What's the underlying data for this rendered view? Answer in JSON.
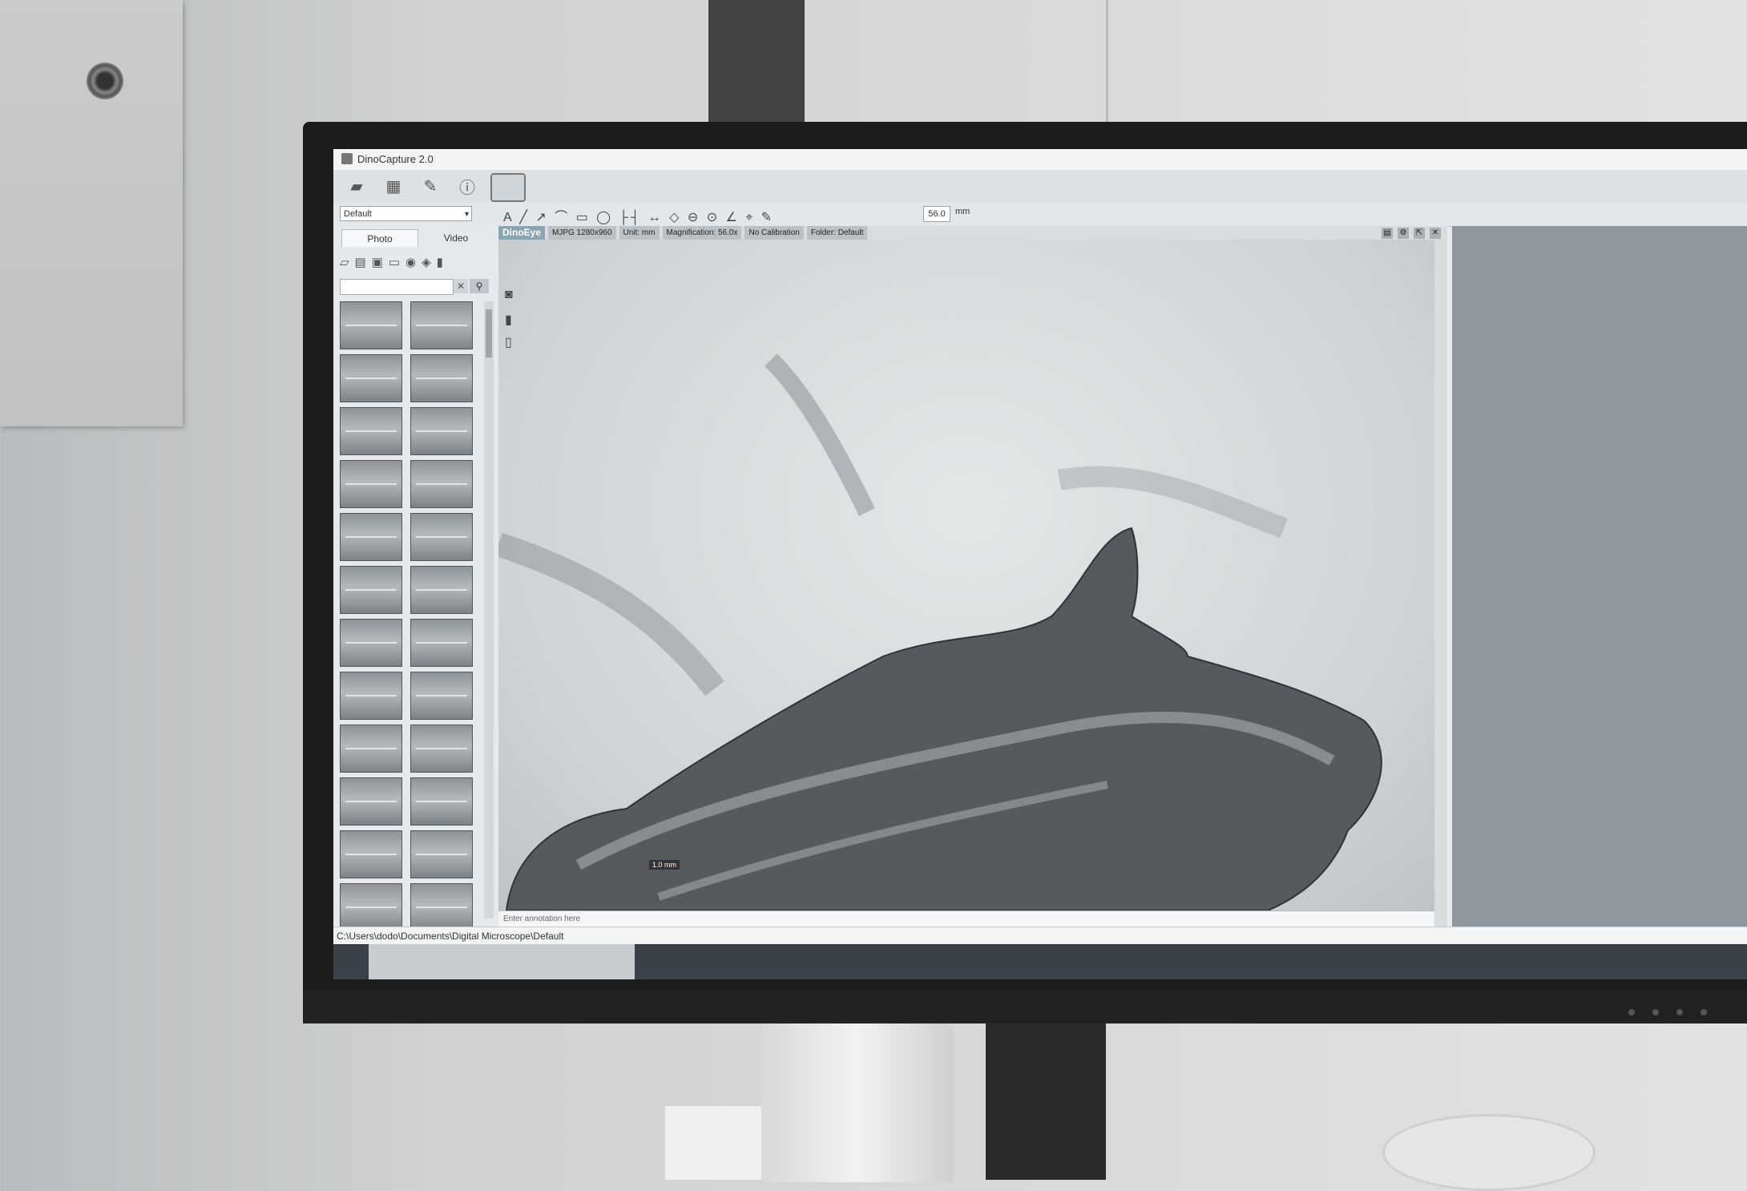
{
  "window": {
    "title": "DinoCapture 2.0"
  },
  "toolbar": {
    "profile_value": "Default",
    "draw_tools": "A ╱ ↗ ⌒ ▭ ◯ ├┤ ↔ ◇ ⊖ ⊙ ∠ ⌖ ✎",
    "zoom_value": "56.0",
    "zoom_unit": "mm"
  },
  "panel": {
    "tabs": [
      "Photo",
      "Video"
    ],
    "active_tab": "Photo"
  },
  "viewer": {
    "brand": "DinoEye",
    "resolution": "MJPG 1280x960",
    "unit": "Unit: mm",
    "magnification": "Magnification: 56.0x",
    "calibration": "No Calibration",
    "folder": "Folder: Default",
    "annotation_placeholder": "Enter annotation here",
    "scale_label": "1.0 mm"
  },
  "status": {
    "path": "C:\\Users\\dodo\\Documents\\Digital Microscope\\Default"
  },
  "icons": {
    "open": "folder-icon",
    "gallery": "gallery-icon",
    "measure": "pen-icon",
    "info": "info-icon",
    "capture": "fullscreen-icon",
    "camera": "camera-icon"
  },
  "colors": {
    "brand_badge": "#8aa4b1",
    "taskbar": "#3a4149",
    "right_panel": "#8f979e"
  }
}
